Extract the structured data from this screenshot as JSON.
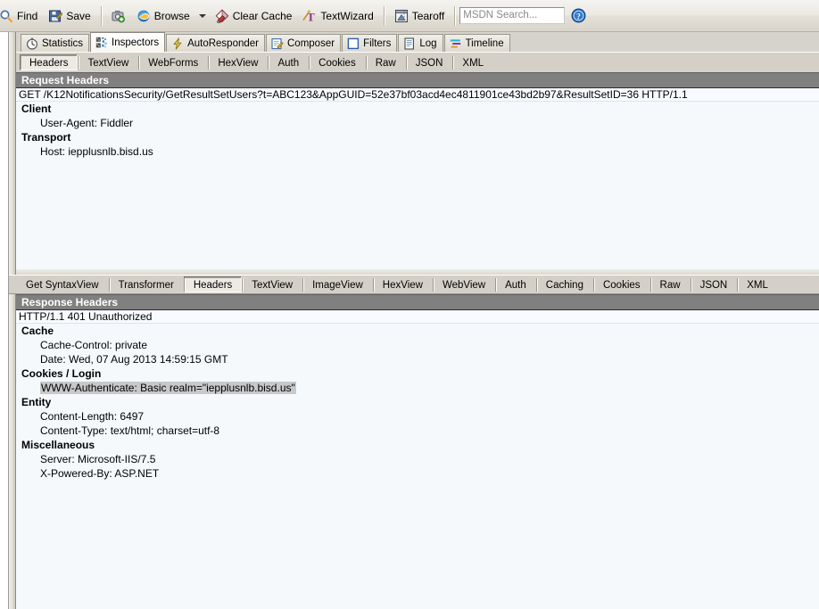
{
  "toolbar": {
    "items": [
      {
        "label": "Find",
        "icon": "find-icon"
      },
      {
        "label": "Save",
        "icon": "save-icon"
      }
    ],
    "capture_icon": "capture-icon",
    "browse": {
      "label": "Browse",
      "icon": "browse-icon",
      "caret": "chevron-down-icon"
    },
    "clear_cache": {
      "label": "Clear Cache",
      "icon": "clear-cache-icon"
    },
    "text_wizard": {
      "label": "TextWizard",
      "icon": "text-wizard-icon"
    },
    "tearoff": {
      "label": "Tearoff",
      "icon": "tearoff-icon"
    },
    "msdn_search": {
      "value": "",
      "placeholder": "MSDN Search..."
    },
    "help_icon": "help-icon"
  },
  "main_tabs": [
    {
      "label": "Statistics",
      "icon": "statistics-icon",
      "selected": false
    },
    {
      "label": "Inspectors",
      "icon": "inspectors-icon",
      "selected": true
    },
    {
      "label": "AutoResponder",
      "icon": "autoresponder-icon",
      "selected": false
    },
    {
      "label": "Composer",
      "icon": "composer-icon",
      "selected": false
    },
    {
      "label": "Filters",
      "icon": "filters-icon",
      "selected": false
    },
    {
      "label": "Log",
      "icon": "log-icon",
      "selected": false
    },
    {
      "label": "Timeline",
      "icon": "timeline-icon",
      "selected": false
    }
  ],
  "request_tabs": [
    {
      "label": "Headers",
      "selected": true
    },
    {
      "label": "TextView",
      "selected": false
    },
    {
      "label": "WebForms",
      "selected": false
    },
    {
      "label": "HexView",
      "selected": false
    },
    {
      "label": "Auth",
      "selected": false
    },
    {
      "label": "Cookies",
      "selected": false
    },
    {
      "label": "Raw",
      "selected": false
    },
    {
      "label": "JSON",
      "selected": false
    },
    {
      "label": "XML",
      "selected": false
    }
  ],
  "response_tabs": [
    {
      "label": "Get SyntaxView",
      "selected": false
    },
    {
      "label": "Transformer",
      "selected": false
    },
    {
      "label": "Headers",
      "selected": true
    },
    {
      "label": "TextView",
      "selected": false
    },
    {
      "label": "ImageView",
      "selected": false
    },
    {
      "label": "HexView",
      "selected": false
    },
    {
      "label": "WebView",
      "selected": false
    },
    {
      "label": "Auth",
      "selected": false
    },
    {
      "label": "Caching",
      "selected": false
    },
    {
      "label": "Cookies",
      "selected": false
    },
    {
      "label": "Raw",
      "selected": false
    },
    {
      "label": "JSON",
      "selected": false
    },
    {
      "label": "XML",
      "selected": false
    }
  ],
  "request": {
    "panel_title": "Request Headers",
    "request_line": "GET /K12NotificationsSecurity/GetResultSetUsers?t=ABC123&AppGUID=52e37bf03acd4ec4811901ce43bd2b97&ResultSetID=36 HTTP/1.1",
    "groups": [
      {
        "name": "Client",
        "items": [
          {
            "text": "User-Agent: Fiddler",
            "highlight": false
          }
        ]
      },
      {
        "name": "Transport",
        "items": [
          {
            "text": "Host: iepplusnlb.bisd.us",
            "highlight": false
          }
        ]
      }
    ]
  },
  "response": {
    "panel_title": "Response Headers",
    "status_line": "HTTP/1.1 401 Unauthorized",
    "groups": [
      {
        "name": "Cache",
        "items": [
          {
            "text": "Cache-Control: private",
            "highlight": false
          },
          {
            "text": "Date: Wed, 07 Aug 2013 14:59:15 GMT",
            "highlight": false
          }
        ]
      },
      {
        "name": "Cookies / Login",
        "items": [
          {
            "text": "WWW-Authenticate: Basic realm=\"iepplusnlb.bisd.us\"",
            "highlight": true
          }
        ]
      },
      {
        "name": "Entity",
        "items": [
          {
            "text": "Content-Length: 6497",
            "highlight": false
          },
          {
            "text": "Content-Type: text/html; charset=utf-8",
            "highlight": false
          }
        ]
      },
      {
        "name": "Miscellaneous",
        "items": [
          {
            "text": "Server: Microsoft-IIS/7.5",
            "highlight": false
          },
          {
            "text": "X-Powered-By: ASP.NET",
            "highlight": false
          }
        ]
      }
    ]
  },
  "colors": {
    "panel_header_bg": "#808080",
    "toolbar_bg": "#ebe9e2",
    "tabstrip_bg": "#d4d0c8",
    "body_bg": "#f5f9fc",
    "highlight_bg": "#c8c8c8"
  }
}
